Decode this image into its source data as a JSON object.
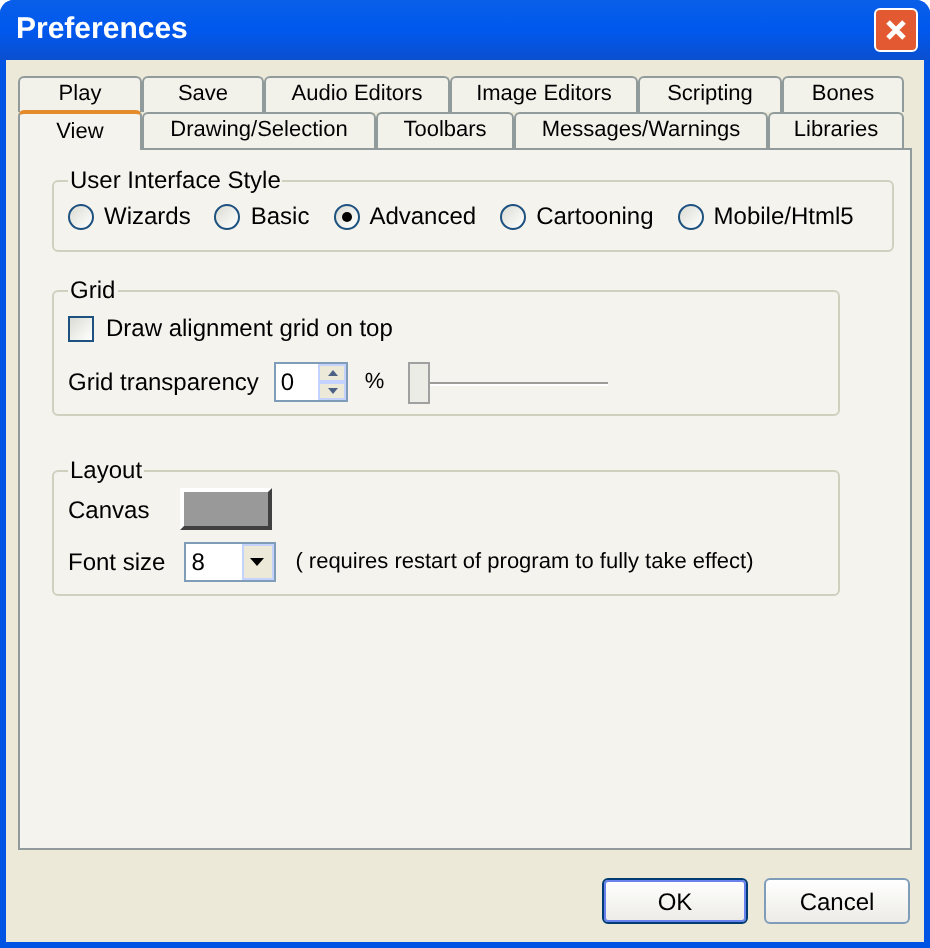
{
  "window": {
    "title": "Preferences"
  },
  "tab_rows": [
    [
      {
        "label": "Play",
        "selected": false
      },
      {
        "label": "Save",
        "selected": false
      },
      {
        "label": "Audio Editors",
        "selected": false
      },
      {
        "label": "Image Editors",
        "selected": false
      },
      {
        "label": "Scripting",
        "selected": false
      },
      {
        "label": "Bones",
        "selected": false
      }
    ],
    [
      {
        "label": "View",
        "selected": true
      },
      {
        "label": "Drawing/Selection",
        "selected": false
      },
      {
        "label": "Toolbars",
        "selected": false
      },
      {
        "label": "Messages/Warnings",
        "selected": false
      },
      {
        "label": "Libraries",
        "selected": false
      }
    ]
  ],
  "ui_style": {
    "title": "User Interface Style",
    "options": [
      {
        "label": "Wizards",
        "selected": false
      },
      {
        "label": "Basic",
        "selected": false
      },
      {
        "label": "Advanced",
        "selected": true
      },
      {
        "label": "Cartooning",
        "selected": false
      },
      {
        "label": "Mobile/Html5",
        "selected": false
      }
    ]
  },
  "grid": {
    "title": "Grid",
    "checkbox": {
      "label": "Draw alignment grid on top",
      "checked": false
    },
    "transparency": {
      "label": "Grid transparency",
      "value": "0",
      "unit": "%",
      "level": 0
    }
  },
  "layout": {
    "title": "Layout",
    "canvas_label": "Canvas",
    "font_size": {
      "label": "Font size",
      "value": "8",
      "note": "( requires restart of program to fully take effect)"
    }
  },
  "buttons": [
    {
      "label": "OK",
      "default": true
    },
    {
      "label": "Cancel",
      "default": false
    }
  ]
}
